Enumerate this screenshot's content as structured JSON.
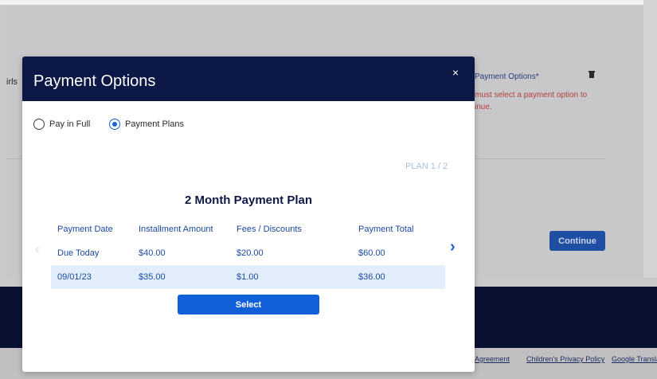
{
  "background": {
    "left_text": "irls",
    "payment_options_label": "Payment Options*",
    "error_text": "must select a payment option to inue.",
    "continue_label": "Continue",
    "footer_links": [
      "Agreement",
      "Children's Privacy Policy",
      "Google Translat"
    ]
  },
  "modal": {
    "title": "Payment Options",
    "close_glyph": "×",
    "options": [
      {
        "label": "Pay in Full",
        "checked": false
      },
      {
        "label": "Payment Plans",
        "checked": true
      }
    ],
    "plan_counter": "PLAN 1 / 2",
    "plan_title": "2 Month Payment Plan",
    "arrow_left": "‹",
    "arrow_right": "›",
    "table": {
      "headers": [
        "Payment Date",
        "Installment Amount",
        "Fees / Discounts",
        "Payment Total"
      ],
      "rows": [
        [
          "Due Today",
          "$40.00",
          "$20.00",
          "$60.00"
        ],
        [
          "09/01/23",
          "$35.00",
          "$1.00",
          "$36.00"
        ]
      ]
    },
    "select_label": "Select"
  },
  "colors": {
    "header_navy": "#0c1946",
    "accent_blue": "#1160d9",
    "row_highlight": "#e2eefc",
    "error_red": "#b2403c"
  }
}
